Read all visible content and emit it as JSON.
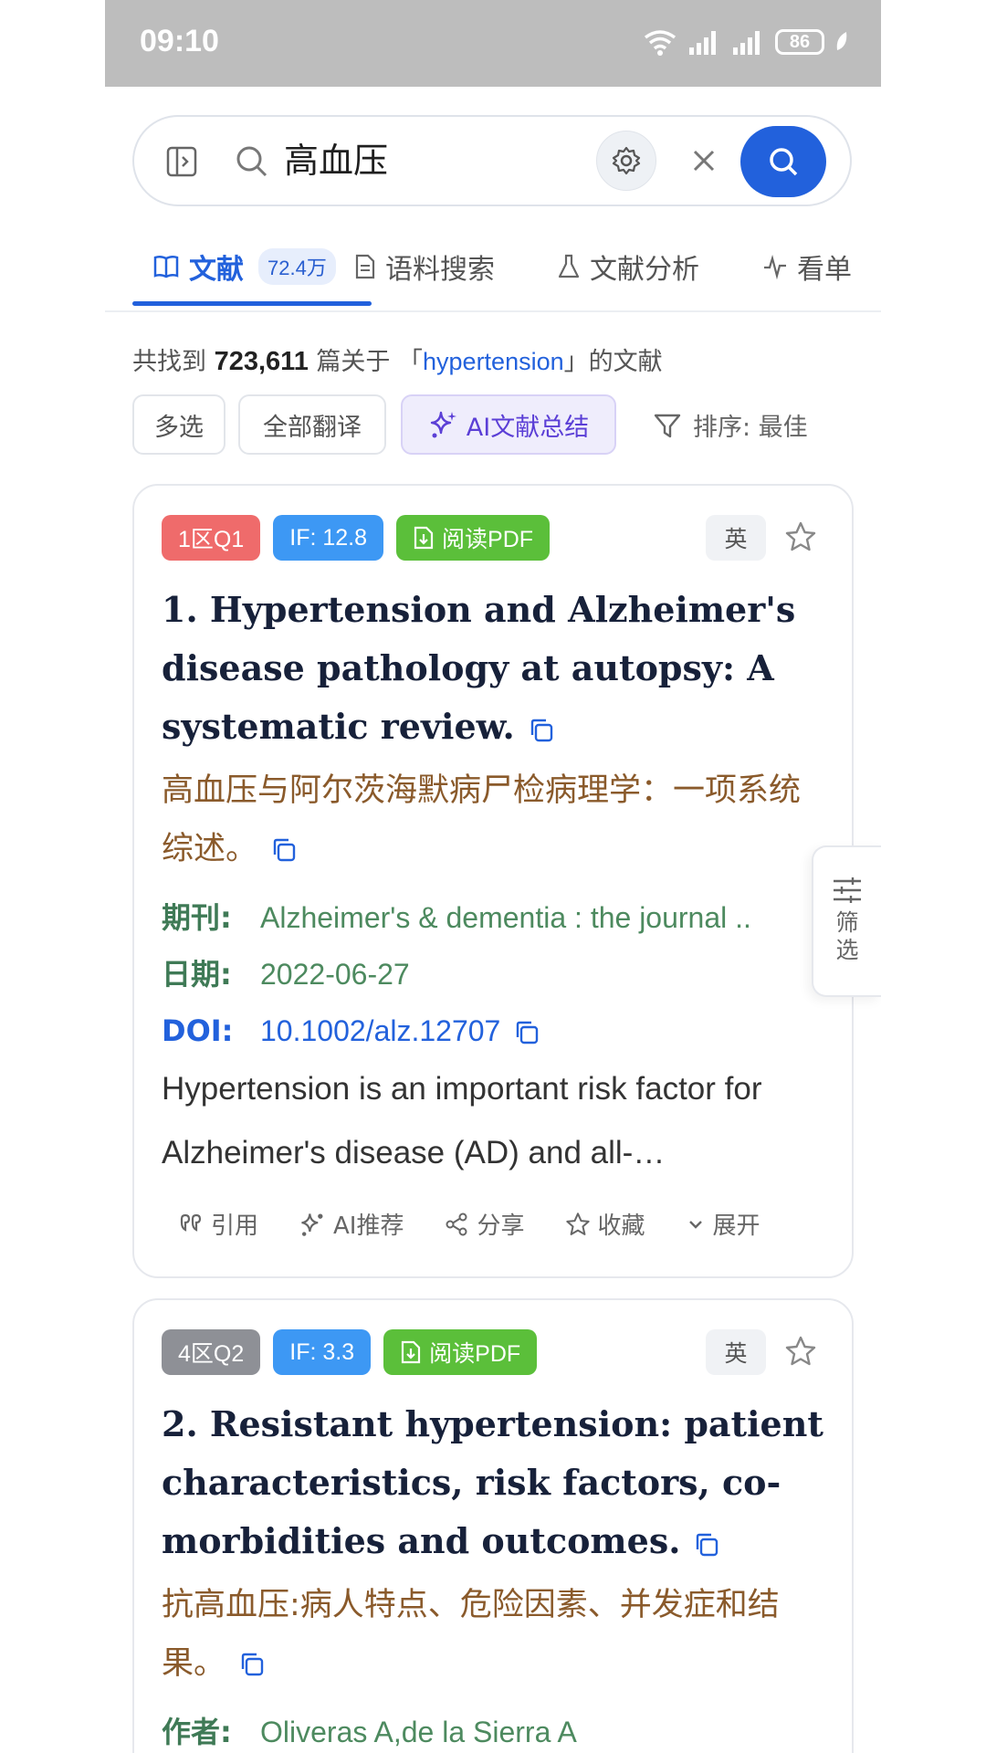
{
  "status_bar": {
    "time": "09:10",
    "battery": "86"
  },
  "search": {
    "query": "高血压"
  },
  "tabs": [
    {
      "label": "文献",
      "count": "72.4万"
    },
    {
      "label": "语料搜索"
    },
    {
      "label": "文献分析"
    },
    {
      "label": "看单"
    }
  ],
  "summary": {
    "prefix": "共找到",
    "count": "723,611",
    "mid": "篇关于 「",
    "term": "hypertension",
    "suffix": "」的文献"
  },
  "actions": {
    "multi_select": "多选",
    "translate_all": "全部翻译",
    "ai_summary": "AI文献总结",
    "sort": "排序: 最佳"
  },
  "filter_float": {
    "label": "筛选"
  },
  "results": [
    {
      "zone": "1区Q1",
      "zone_color": "#ef6b6b",
      "impact": "IF: 12.8",
      "pdf": "阅读PDF",
      "lang": "英",
      "title_en": "1. Hypertension and Alzheimer's disease pathology at autopsy: A systematic review.",
      "title_zh": "高血压与阿尔茨海默病尸检病理学：一项系统综述。",
      "journal_label": "期刊:",
      "journal": "Alzheimer's & dementia : the journal ..",
      "date_label": "日期:",
      "date": "2022-06-27",
      "doi_label": "DOI:",
      "doi": "10.1002/alz.12707",
      "abstract": "Hypertension is an important risk factor for Alzheimer's disease (AD) and all-…",
      "actions": {
        "cite": "引用",
        "ai_recommend": "AI推荐",
        "share": "分享",
        "favorite": "收藏",
        "expand": "展开"
      }
    },
    {
      "zone": "4区Q2",
      "zone_color": "#8e9096",
      "impact": "IF: 3.3",
      "pdf": "阅读PDF",
      "lang": "英",
      "title_en": "2. Resistant hypertension: patient characteristics, risk factors, co-morbidities and outcomes.",
      "title_zh": "抗高血压:病人特点、危险因素、并发症和结果。",
      "author_label": "作者:",
      "authors": "Oliveras A,de la Sierra A"
    }
  ],
  "colors": {
    "accent": "#2261dc",
    "if_badge": "#3d98f4",
    "pdf_badge": "#5bbf3a",
    "ai_purple": "#5b3fd6"
  }
}
